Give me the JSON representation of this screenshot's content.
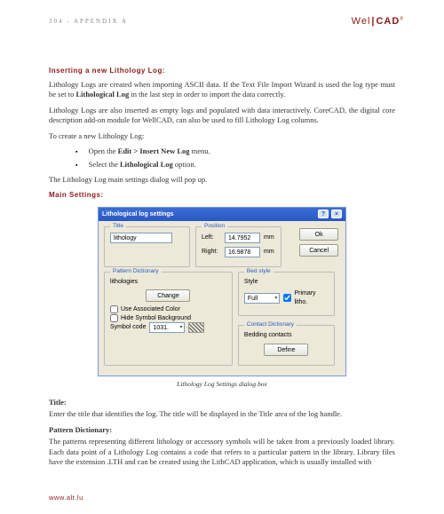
{
  "header": {
    "pageinfo": "304 - APPENDIX A",
    "brand_left": "Wel",
    "brand_right": "CAD"
  },
  "section1": {
    "heading": "Inserting a new Lithology Log:",
    "p1a": "Lithology Logs are created when importing ASCII data. If the Text File Import Wizard is used the log type must be set to ",
    "p1b": "Lithological Log",
    "p1c": " in the last step in order to import the data correctly.",
    "p2": "Lithology Logs are also inserted as empty logs and populated with data interactively. CoreCAD, the digital core description add-on module for WellCAD, can also be used to fill Lithology Log columns.",
    "p3": "To create a new Lithology Log:",
    "li1a": "Open the ",
    "li1b": "Edit > Insert New Log",
    "li1c": " menu.",
    "li2a": "Select the ",
    "li2b": "Lithological Log",
    "li2c": " option.",
    "p4": "The Lithology Log main settings dialog will pop up.",
    "heading2": "Main Settings:"
  },
  "dialog": {
    "title": "Lithological log settings",
    "grp_title": "Title",
    "title_val": "lithology",
    "grp_position": "Position",
    "left_lbl": "Left:",
    "left_val": "14.7952",
    "right_lbl": "Right:",
    "right_val": "16.9878",
    "grp_pattern": "Pattern Dictionary",
    "lith_lbl": "lithologies",
    "change_btn": "Change",
    "use_assoc": "Use Associated Color",
    "hide_bg": "Hide Symbol Background",
    "symcode_lbl": "Symbol code",
    "symcode_val": "1031.",
    "grp_bed": "Bed style",
    "bed_style": "Style",
    "bed_val": "Full",
    "primary": "Primary litho.",
    "grp_contact": "Contact Dictionary",
    "contact_lbl": "Bedding contacts",
    "define_btn": "Define",
    "ok": "Ok",
    "cancel": "Cancel",
    "mm": "mm"
  },
  "caption": "Lithology Log Settings dialog box",
  "body2": {
    "title_h": "Title:",
    "title_p": "Enter the title that identifies the log. The title will be displayed in the Title area of the log handle.",
    "pat_h": "Pattern Dictionary:",
    "pat_p": "The patterns representing different lithology or accessory symbols will be taken from a previously loaded library. Each data point of a Lithology Log contains a code that refers to a particular pattern in the library. Library files have the extension .LTH and can be created using the LithCAD application, which is usually installed with"
  },
  "footer": "www.alt.lu"
}
